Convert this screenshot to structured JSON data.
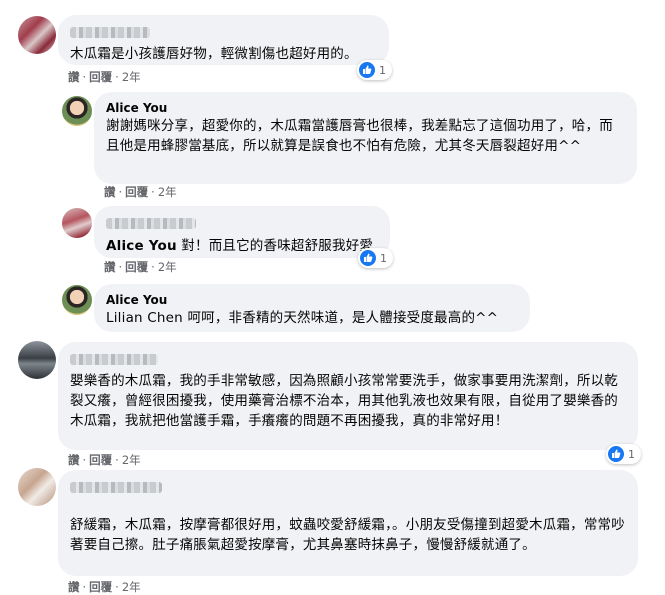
{
  "comments": [
    {
      "author": "",
      "text": "木瓜霜是小孩護唇好物，輕微割傷也超好用的。",
      "actions": {
        "like": "讚",
        "reply": "回覆",
        "time": "2年"
      },
      "reactions": {
        "count": "1",
        "icon": "like-icon"
      }
    },
    {
      "author": "Alice You",
      "text": "謝謝媽咪分享，超愛你的，木瓜霜當護唇膏也很棒，我差點忘了這個功用了，哈，而且他是用蜂膠當基底，所以就算是誤食也不怕有危險，尤其冬天唇裂超好用^^",
      "actions": {
        "like": "讚",
        "reply": "回覆",
        "time": "2年"
      }
    },
    {
      "author": "",
      "tag": "Alice You",
      "text": "對！而且它的香味超舒服我好愛",
      "actions": {
        "like": "讚",
        "reply": "回覆",
        "time": "2年"
      },
      "reactions": {
        "count": "1",
        "icon": "like-icon"
      }
    },
    {
      "author": "Alice You",
      "tag": "Lilian Chen",
      "text": "呵呵，非香精的天然味道，是人體接受度最高的^^"
    },
    {
      "author": "",
      "text": "嬰樂香的木瓜霜，我的手非常敏感，因為照顧小孩常常要洗手，做家事要用洗潔劑，所以乾裂又癢，曾經很困擾我，使用藥膏治標不治本，用其他乳液也效果有限，自從用了嬰樂香的木瓜霜，我就把他當護手霜，手癢癢的問題不再困擾我，真的非常好用！",
      "actions": {
        "like": "讚",
        "reply": "回覆",
        "time": "2年"
      },
      "reactions": {
        "count": "1",
        "icon": "like-icon"
      }
    },
    {
      "author": "",
      "text": "舒緩霜，木瓜霜，按摩膏都很好用，蚊蟲咬愛舒緩霜，。小朋友受傷撞到超愛木瓜霜，常常吵著要自己擦。肚子痛脹氣超愛按摩膏，尤其鼻塞時抹鼻子，慢慢舒緩就通了。",
      "actions": {
        "like": "讚",
        "reply": "回覆",
        "time": "2年"
      }
    }
  ],
  "colors": {
    "bubble": "#f0f2f5",
    "text": "#050505",
    "meta": "#65676b",
    "like": "#1877f2"
  }
}
